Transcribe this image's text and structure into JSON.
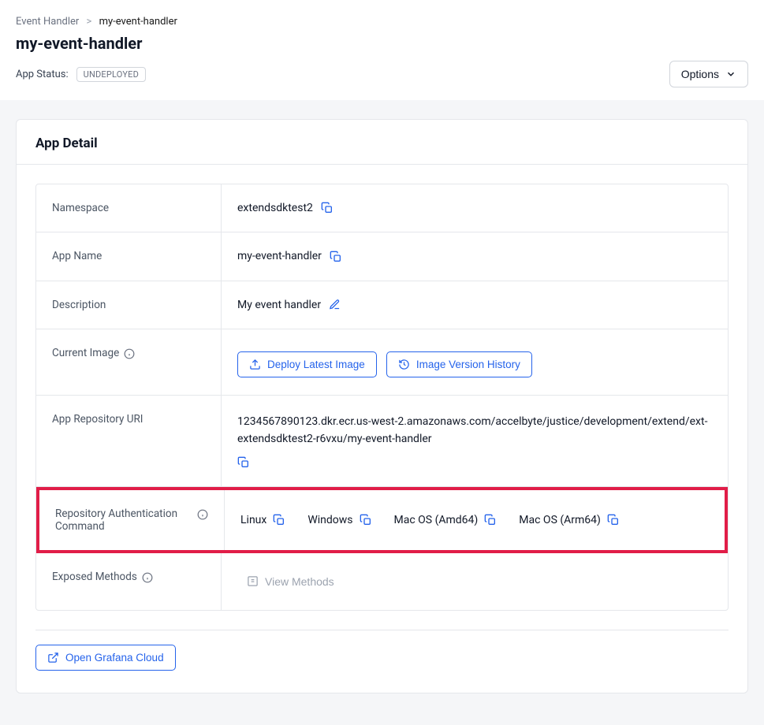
{
  "breadcrumb": {
    "parent": "Event Handler",
    "current": "my-event-handler"
  },
  "page_title": "my-event-handler",
  "status": {
    "label": "App Status:",
    "value": "UNDEPLOYED"
  },
  "options_button": "Options",
  "card": {
    "title": "App Detail"
  },
  "rows": {
    "namespace": {
      "label": "Namespace",
      "value": "extendsdktest2"
    },
    "app_name": {
      "label": "App Name",
      "value": "my-event-handler"
    },
    "description": {
      "label": "Description",
      "value": "My event handler"
    },
    "current_image": {
      "label": "Current Image",
      "deploy_btn": "Deploy Latest Image",
      "history_btn": "Image Version History"
    },
    "repo_uri": {
      "label": "App Repository URI",
      "value": "1234567890123.dkr.ecr.us-west-2.amazonaws.com/accelbyte/justice/development/extend/ext-extendsdktest2-r6vxu/my-event-handler"
    },
    "repo_auth": {
      "label": "Repository Authentication Command",
      "os": {
        "linux": "Linux",
        "windows": "Windows",
        "mac_amd": "Mac OS (Amd64)",
        "mac_arm": "Mac OS (Arm64)"
      }
    },
    "exposed_methods": {
      "label": "Exposed Methods",
      "button": "View Methods"
    }
  },
  "footer": {
    "grafana": "Open Grafana Cloud"
  }
}
